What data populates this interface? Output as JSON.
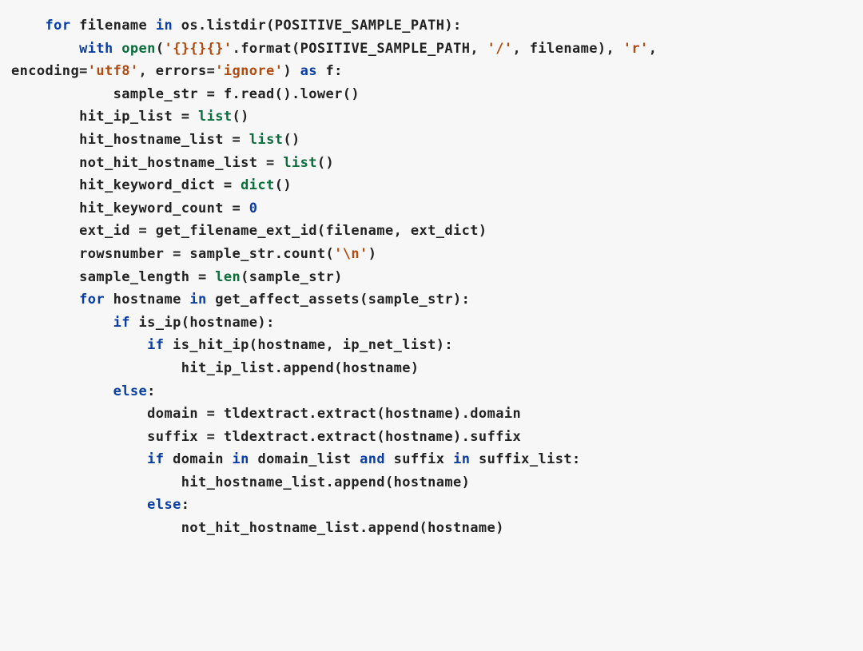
{
  "code": {
    "lines": [
      {
        "indent": 1,
        "tok": [
          {
            "c": "kw",
            "t": "for"
          },
          {
            "c": "pl",
            "t": " filename "
          },
          {
            "c": "kw",
            "t": "in"
          },
          {
            "c": "pl",
            "t": " os.listdir(POSITIVE_SAMPLE_PATH):"
          }
        ]
      },
      {
        "indent": 2,
        "tok": [
          {
            "c": "kw",
            "t": "with"
          },
          {
            "c": "pl",
            "t": " "
          },
          {
            "c": "bi",
            "t": "open"
          },
          {
            "c": "pl",
            "t": "("
          },
          {
            "c": "str",
            "t": "'{}{}{}'"
          },
          {
            "c": "pl",
            "t": ".format(POSITIVE_SAMPLE_PATH, "
          },
          {
            "c": "str",
            "t": "'/'"
          },
          {
            "c": "pl",
            "t": ", filename), "
          },
          {
            "c": "str",
            "t": "'r'"
          },
          {
            "c": "pl",
            "t": ","
          }
        ]
      },
      {
        "indent": 0,
        "tok": [
          {
            "c": "pl",
            "t": "encoding="
          },
          {
            "c": "str",
            "t": "'utf8'"
          },
          {
            "c": "pl",
            "t": ", errors="
          },
          {
            "c": "str",
            "t": "'ignore'"
          },
          {
            "c": "pl",
            "t": ") "
          },
          {
            "c": "kw",
            "t": "as"
          },
          {
            "c": "pl",
            "t": " f:"
          }
        ]
      },
      {
        "indent": 3,
        "tok": [
          {
            "c": "pl",
            "t": "sample_str = f.read().lower()"
          }
        ]
      },
      {
        "indent": 0,
        "tok": [
          {
            "c": "pl",
            "t": ""
          }
        ]
      },
      {
        "indent": 2,
        "tok": [
          {
            "c": "pl",
            "t": "hit_ip_list = "
          },
          {
            "c": "bi",
            "t": "list"
          },
          {
            "c": "pl",
            "t": "()"
          }
        ]
      },
      {
        "indent": 2,
        "tok": [
          {
            "c": "pl",
            "t": "hit_hostname_list = "
          },
          {
            "c": "bi",
            "t": "list"
          },
          {
            "c": "pl",
            "t": "()"
          }
        ]
      },
      {
        "indent": 2,
        "tok": [
          {
            "c": "pl",
            "t": "not_hit_hostname_list = "
          },
          {
            "c": "bi",
            "t": "list"
          },
          {
            "c": "pl",
            "t": "()"
          }
        ]
      },
      {
        "indent": 2,
        "tok": [
          {
            "c": "pl",
            "t": "hit_keyword_dict = "
          },
          {
            "c": "bi",
            "t": "dict"
          },
          {
            "c": "pl",
            "t": "()"
          }
        ]
      },
      {
        "indent": 2,
        "tok": [
          {
            "c": "pl",
            "t": "hit_keyword_count = "
          },
          {
            "c": "num",
            "t": "0"
          }
        ]
      },
      {
        "indent": 0,
        "tok": [
          {
            "c": "pl",
            "t": ""
          }
        ]
      },
      {
        "indent": 2,
        "tok": [
          {
            "c": "pl",
            "t": "ext_id = get_filename_ext_id(filename, ext_dict)"
          }
        ]
      },
      {
        "indent": 2,
        "tok": [
          {
            "c": "pl",
            "t": "rowsnumber = sample_str.count("
          },
          {
            "c": "str",
            "t": "'\\n'"
          },
          {
            "c": "pl",
            "t": ")"
          }
        ]
      },
      {
        "indent": 2,
        "tok": [
          {
            "c": "pl",
            "t": "sample_length = "
          },
          {
            "c": "bi",
            "t": "len"
          },
          {
            "c": "pl",
            "t": "(sample_str)"
          }
        ]
      },
      {
        "indent": 0,
        "tok": [
          {
            "c": "pl",
            "t": ""
          }
        ]
      },
      {
        "indent": 2,
        "tok": [
          {
            "c": "kw",
            "t": "for"
          },
          {
            "c": "pl",
            "t": " hostname "
          },
          {
            "c": "kw",
            "t": "in"
          },
          {
            "c": "pl",
            "t": " get_affect_assets(sample_str):"
          }
        ]
      },
      {
        "indent": 3,
        "tok": [
          {
            "c": "kw",
            "t": "if"
          },
          {
            "c": "pl",
            "t": " is_ip(hostname):"
          }
        ]
      },
      {
        "indent": 4,
        "tok": [
          {
            "c": "kw",
            "t": "if"
          },
          {
            "c": "pl",
            "t": " is_hit_ip(hostname, ip_net_list):"
          }
        ]
      },
      {
        "indent": 5,
        "tok": [
          {
            "c": "pl",
            "t": "hit_ip_list.append(hostname)"
          }
        ]
      },
      {
        "indent": 3,
        "tok": [
          {
            "c": "kw",
            "t": "else"
          },
          {
            "c": "pl",
            "t": ":"
          }
        ]
      },
      {
        "indent": 4,
        "tok": [
          {
            "c": "pl",
            "t": "domain = tldextract.extract(hostname).domain"
          }
        ]
      },
      {
        "indent": 4,
        "tok": [
          {
            "c": "pl",
            "t": "suffix = tldextract.extract(hostname).suffix"
          }
        ]
      },
      {
        "indent": 0,
        "tok": [
          {
            "c": "pl",
            "t": ""
          }
        ]
      },
      {
        "indent": 4,
        "tok": [
          {
            "c": "kw",
            "t": "if"
          },
          {
            "c": "pl",
            "t": " domain "
          },
          {
            "c": "kw",
            "t": "in"
          },
          {
            "c": "pl",
            "t": " domain_list "
          },
          {
            "c": "kw",
            "t": "and"
          },
          {
            "c": "pl",
            "t": " suffix "
          },
          {
            "c": "kw",
            "t": "in"
          },
          {
            "c": "pl",
            "t": " suffix_list:"
          }
        ]
      },
      {
        "indent": 5,
        "tok": [
          {
            "c": "pl",
            "t": "hit_hostname_list.append(hostname)"
          }
        ]
      },
      {
        "indent": 4,
        "tok": [
          {
            "c": "kw",
            "t": "else"
          },
          {
            "c": "pl",
            "t": ":"
          }
        ]
      },
      {
        "indent": 5,
        "tok": [
          {
            "c": "pl",
            "t": "not_hit_hostname_list.append(hostname)"
          }
        ]
      }
    ]
  }
}
